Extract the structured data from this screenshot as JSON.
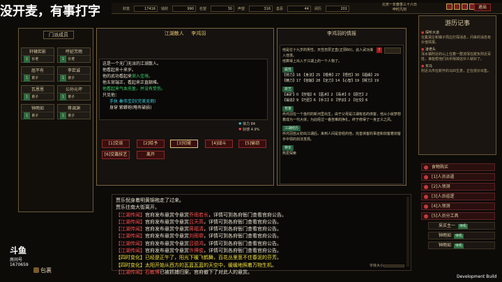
{
  "overlay": {
    "title": "没开麦，有事打字",
    "room_label": "房间号",
    "room_id": "1670659",
    "logo": "斗鱼"
  },
  "topbar": {
    "stats": [
      {
        "label": "财富",
        "value": "17416"
      },
      {
        "label": "钱财",
        "value": "990"
      },
      {
        "label": "名望",
        "value": "30"
      },
      {
        "label": "声望",
        "value": "316"
      },
      {
        "label": "善恶",
        "value": "44"
      },
      {
        "label": "阅历",
        "value": "201"
      }
    ],
    "date_line1": "北宋一年春季三十六日",
    "date_line2": "申时凡刻",
    "exit_label": "退出",
    "menu_icons": [
      "地图",
      "人物",
      "背包",
      "设置"
    ]
  },
  "left_panel": {
    "title": "门派成员",
    "members": [
      {
        "name": "轩辕若影",
        "tag": "1",
        "rank": "长老"
      },
      {
        "name": "呼延芳雨",
        "tag": "1",
        "rank": "长老"
      },
      {
        "name": "屈不有",
        "tag": "1",
        "rank": "弟子"
      },
      {
        "name": "李若诚",
        "tag": "1",
        "rank": "弟子"
      },
      {
        "name": "瓦恩恩",
        "tag": "1",
        "rank": "弟子"
      },
      {
        "name": "公孙元坏",
        "tag": "1",
        "rank": "弟子"
      },
      {
        "name": "钟雨如",
        "tag": "1",
        "rank": "弟子"
      },
      {
        "name": "蒋调渊",
        "tag": "1",
        "rank": "弟子"
      }
    ],
    "bag_label": "包裹"
  },
  "npc_dialog": {
    "title_left": "江湖散人",
    "title_right": "李鸿羽",
    "lines": [
      {
        "text": "这是一个无门无派的江湖散人。",
        "color": "white"
      },
      {
        "text": "他看起来十来岁。",
        "color": "white"
      },
      {
        "text": "他的武功看起来",
        "color": "white",
        "highlight": "渐入佳境。",
        "hcolor": "green"
      },
      {
        "text": "他五官端正，看起来正直颇难。",
        "color": "white"
      },
      {
        "text": "他看起来气血充盈，并没有受伤。",
        "color": "green"
      },
      {
        "text": "只见他：",
        "color": "white"
      },
      {
        "text": "手执 秦伟宝剑(完美无瑕)",
        "color": "cyan"
      },
      {
        "text": "身穿 紫蟒袍(略有破损)",
        "color": "white"
      }
    ],
    "hp_label": "体力",
    "hp_value": "84",
    "mp_label": "好感",
    "mp_value": "4.9%",
    "buttons": [
      "[1]交谈",
      "[2]给予",
      "[3]切磋",
      "[4]战斗",
      "[5]偷窃",
      "[6]交篇技艺",
      "离开"
    ]
  },
  "info_panel": {
    "title": "李鸿羽的情报",
    "intro": "他是位十九岁的男性，天性忠厚正直(正邪60)，此人武功渐入佳境。",
    "intro2": "他算得上出入于江湖上的一个人物了。",
    "sections": [
      {
        "label": "属性",
        "rows": [
          "【劳力】16 【身法】25 【根骨】27 【悟性】30 【福缘】29",
          "【精力】17 【容貌】28 【定力】14 【心智】19 【臂力】19"
        ]
      },
      {
        "label": "技艺",
        "rows": [
          "【采矿】0 【狩猎】6 【医术】2 【毒术】0 【厨艺】2",
          "【锻造】9 【巧匠】6 【手工】0 【学识】2 【社交】6"
        ]
      },
      {
        "label": "背景",
        "rows": [
          "乔鸿羽在一个渔村的新河里出生，由于父母是江湖有名的侠客，他从小就梦想着成为一代大侠，为此经过一番苦难的挣扎，终于修得了一身正义之风。"
        ]
      },
      {
        "label": "江湖经历",
        "rows": [
          "乔鸿羽自从初出江湖后，来到人间是曾经的他，完善侠客的事迹和剑客着剑客手中领的剑法发扬。"
        ]
      },
      {
        "label": "特长",
        "rows": [
          "热爱探索"
        ]
      }
    ]
  },
  "right_panel": {
    "title": "游历记事",
    "entries": [
      {
        "head": "探听大道",
        "text": "在集贤庄和镇子周边打探消息，问来的消息有价值情报。"
      },
      {
        "head": "凌老头",
        "text": "浑水镇附近的山上住着一群流氓在欺负附近百姓，谁能帮他们出手除掉这伙人就好了。"
      },
      {
        "head": "买马",
        "text": "附近马市在新开的马匹生意，正在低价出售。"
      }
    ],
    "side_items": [
      {
        "label": "食物购买",
        "sub": false
      },
      {
        "label": "[1]人员派遣",
        "sub": false
      },
      {
        "label": "[2]入领测",
        "sub": false
      },
      {
        "label": "[3]人员巡逻",
        "sub": false
      },
      {
        "label": "[4]入领测",
        "sub": false
      },
      {
        "label": "[5]人员分工具",
        "sub": false
      },
      {
        "label": "采买主一",
        "sub": true,
        "lv": "待机"
      },
      {
        "label": "钟雨如",
        "sub": true,
        "lv": "待机"
      },
      {
        "label": "钟雨如",
        "sub": true,
        "lv": "待机"
      }
    ]
  },
  "log": {
    "head_lines": [
      {
        "text": "贾乐倪身着明黄锦袍走了过来。",
        "color": "white"
      },
      {
        "text": "贾乐往南大街离开。",
        "color": "white"
      }
    ],
    "lines": [
      {
        "tag": "【江湖传闻】",
        "text": "官府发布悬赏令悬赏",
        "name": "乔雨若长",
        "rest": "，详情可到各府衙门查看官府公告。"
      },
      {
        "tag": "【江湖传闻】",
        "text": "官府发布悬赏令悬赏",
        "name": "吕天高",
        "rest": "，详情可到各府衙门查看官府公告。"
      },
      {
        "tag": "【江湖传闻】",
        "text": "官府发布悬赏令悬赏",
        "name": "蒋福清",
        "rest": "，详情可到各府衙门查看官府公告。"
      },
      {
        "tag": "【江湖传闻】",
        "text": "官府发布悬赏令悬赏",
        "name": "刘雨霏",
        "rest": "，详情可到各府衙门查看官府公告。"
      },
      {
        "tag": "【江湖传闻】",
        "text": "官府发布悬赏令悬赏",
        "name": "吕德鸿",
        "rest": "，详情可到各府衙门查看官府公告。"
      },
      {
        "tag": "【江湖传闻】",
        "text": "官府发布悬赏令悬赏",
        "name": "许博俊",
        "rest": "，详情可到各府衙门查看官府公告。"
      }
    ],
    "weather1": {
      "tag": "【四时变化】",
      "text": "已经是正午了，阳光下暖飞鹤舞，百花丛里葱不住春泥的芬芳。"
    },
    "weather2": {
      "tag": "【四时变化】",
      "text": "太阳开始从西方的瓦蓝瓦蓝的天空中，缓缓地照着万物生机。"
    },
    "last": {
      "tag": "【江湖传闻】",
      "name": "石敏博",
      "text": "已被抓捕归案，官府撤下了对此人的悬赏。"
    },
    "footer_label": "字体大小"
  },
  "dev_build": "Development Build"
}
